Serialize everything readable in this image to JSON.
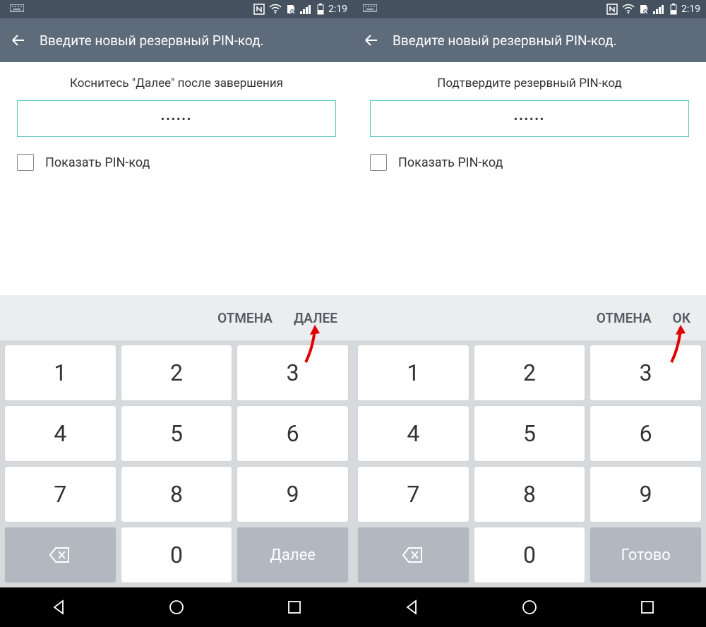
{
  "status": {
    "time": "2:19"
  },
  "screens": [
    {
      "title": "Введите новый резервный PIN-код.",
      "instruction": "Коснитесь \"Далее\" после завершения",
      "pin_mask": "••••••",
      "checkbox_label": "Показать PIN-код",
      "cancel_label": "ОТМЕНА",
      "confirm_label": "ДАЛЕЕ",
      "keypad": {
        "nums": [
          "1",
          "2",
          "3",
          "4",
          "5",
          "6",
          "7",
          "8",
          "9",
          "0"
        ],
        "done_label": "Далее"
      }
    },
    {
      "title": "Введите новый резервный PIN-код.",
      "instruction": "Подтвердите резервный PIN-код",
      "pin_mask": "••••••",
      "checkbox_label": "Показать PIN-код",
      "cancel_label": "ОТМЕНА",
      "confirm_label": "ОК",
      "keypad": {
        "nums": [
          "1",
          "2",
          "3",
          "4",
          "5",
          "6",
          "7",
          "8",
          "9",
          "0"
        ],
        "done_label": "Готово"
      }
    }
  ]
}
